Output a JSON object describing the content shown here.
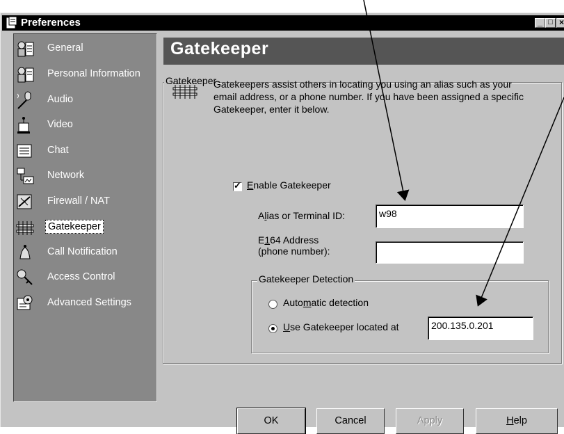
{
  "window": {
    "title": "Preferences"
  },
  "titlebar_buttons": [
    "minimize-icon",
    "maximize-icon",
    "close-icon"
  ],
  "sidebar": {
    "items": [
      {
        "label": "General",
        "icon": "general-icon"
      },
      {
        "label": "Personal Information",
        "icon": "personal-info-icon"
      },
      {
        "label": "Audio",
        "icon": "microphone-icon"
      },
      {
        "label": "Video",
        "icon": "camera-icon"
      },
      {
        "label": "Chat",
        "icon": "chat-icon"
      },
      {
        "label": "Network",
        "icon": "network-icon"
      },
      {
        "label": "Firewall / NAT",
        "icon": "firewall-icon"
      },
      {
        "label": "Gatekeeper",
        "icon": "gatekeeper-icon"
      },
      {
        "label": "Call Notification",
        "icon": "bell-icon"
      },
      {
        "label": "Access Control",
        "icon": "key-icon"
      },
      {
        "label": "Advanced Settings",
        "icon": "settings-icon"
      }
    ],
    "selected": "Gatekeeper"
  },
  "content": {
    "header": "Gatekeeper",
    "group_label": "Gatekeeper",
    "description": "Gatekeepers assist others in locating you using an alias such as your email address, or a phone number.  If you have been assigned a specific Gatekeeper, enter it below.",
    "enable": {
      "label_prefix": "",
      "label_hotkey": "E",
      "label_rest": "nable Gatekeeper",
      "checked": true
    },
    "alias": {
      "label_a": "A",
      "label_hotkey": "l",
      "label_b": "ias or Terminal ID:",
      "value": "w98"
    },
    "e164": {
      "label_a": "E",
      "label_hotkey": "1",
      "label_b": "64 Address",
      "label_line2": "(phone number):",
      "value": ""
    },
    "detection": {
      "legend": "Gatekeeper Detection",
      "auto": {
        "label_a": "Auto",
        "label_hotkey": "m",
        "label_b": "atic detection",
        "selected": false
      },
      "use": {
        "label_a": "",
        "label_hotkey": "U",
        "label_b": "se Gatekeeper located at",
        "selected": true,
        "value": "200.135.0.201"
      }
    }
  },
  "buttons": {
    "ok": "OK",
    "cancel": "Cancel",
    "apply": "Apply",
    "help_hotkey": "H",
    "help_rest": "elp"
  }
}
